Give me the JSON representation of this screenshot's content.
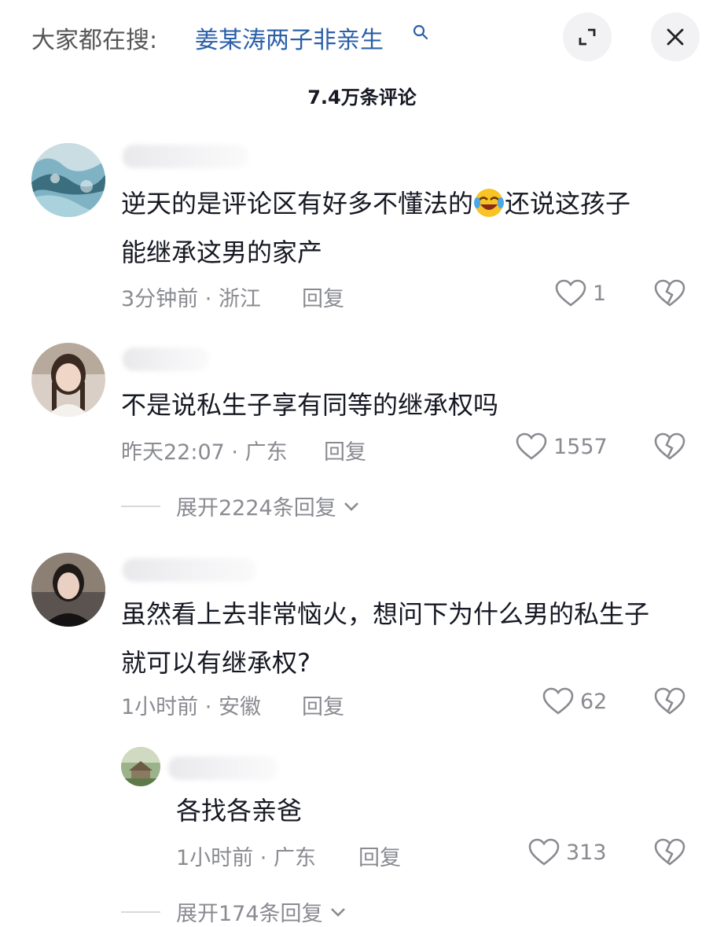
{
  "header": {
    "search_prefix": "大家都在搜:",
    "search_term": "姜某涛两子非亲生"
  },
  "comment_count": "7.4万条评论",
  "comments": [
    {
      "text_before": "逆天的是评论区有好多不懂法的",
      "emoji": "laughing-crying-emoji",
      "text_after": "还说这孩子",
      "text_line2": "能继承这男的家产",
      "time": "3分钟前",
      "location": "浙江",
      "reply": "回复",
      "likes": "1"
    },
    {
      "text": "不是说私生子享有同等的继承权吗",
      "time": "昨天22:07",
      "location": "广东",
      "reply": "回复",
      "likes": "1557",
      "expand": "展开2224条回复"
    },
    {
      "text": "虽然看上去非常恼火，想问下为什么男的私生子",
      "text_line2": "就可以有继承权?",
      "time": "1小时前",
      "location": "安徽",
      "reply": "回复",
      "likes": "62",
      "sub_reply": {
        "text": "各找各亲爸",
        "time": "1小时前",
        "location": "广东",
        "reply": "回复",
        "likes": "313"
      },
      "expand": "展开174条回复"
    }
  ],
  "meta_separator": "·",
  "colors": {
    "search_term": "#2b5fa8",
    "meta_gray": "#8a8b91",
    "text": "#161823"
  }
}
